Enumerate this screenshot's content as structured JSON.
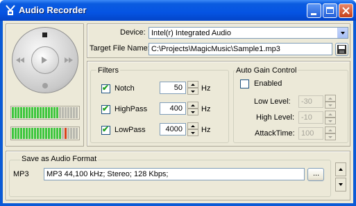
{
  "window": {
    "title": "Audio Recorder"
  },
  "transport": {
    "stop_icon": "stop-icon",
    "play_icon": "play-icon",
    "rewind_icon": "rewind-icon",
    "forward_icon": "fast-forward-icon",
    "record_icon": "record-icon"
  },
  "meters": {
    "left_level": 0.72,
    "right_level": 0.75,
    "right_peak": 0.8
  },
  "device": {
    "label": "Device:",
    "value": "Intel(r) Integrated Audio"
  },
  "target_file": {
    "label": "Target File Name:",
    "value": "C:\\Projects\\MagicMusic\\Sample1.mp3",
    "save_icon": "floppy-disk-icon"
  },
  "filters": {
    "title": "Filters",
    "items": [
      {
        "label": "Notch",
        "checked": true,
        "value": "50",
        "unit": "Hz"
      },
      {
        "label": "HighPass",
        "checked": true,
        "value": "400",
        "unit": "Hz"
      },
      {
        "label": "LowPass",
        "checked": true,
        "value": "4000",
        "unit": "Hz"
      }
    ]
  },
  "agc": {
    "title": "Auto Gain Control",
    "enabled_label": "Enabled",
    "enabled": false,
    "fields": [
      {
        "label": "Low Level:",
        "value": "-30"
      },
      {
        "label": "High Level:",
        "value": "-10"
      },
      {
        "label": "AttackTime:",
        "value": "100"
      }
    ]
  },
  "format": {
    "title": "Save as Audio Format",
    "codec": "MP3",
    "description": "MP3 44,100 kHz; Stereo;  128 Kbps;",
    "browse_label": "..."
  }
}
